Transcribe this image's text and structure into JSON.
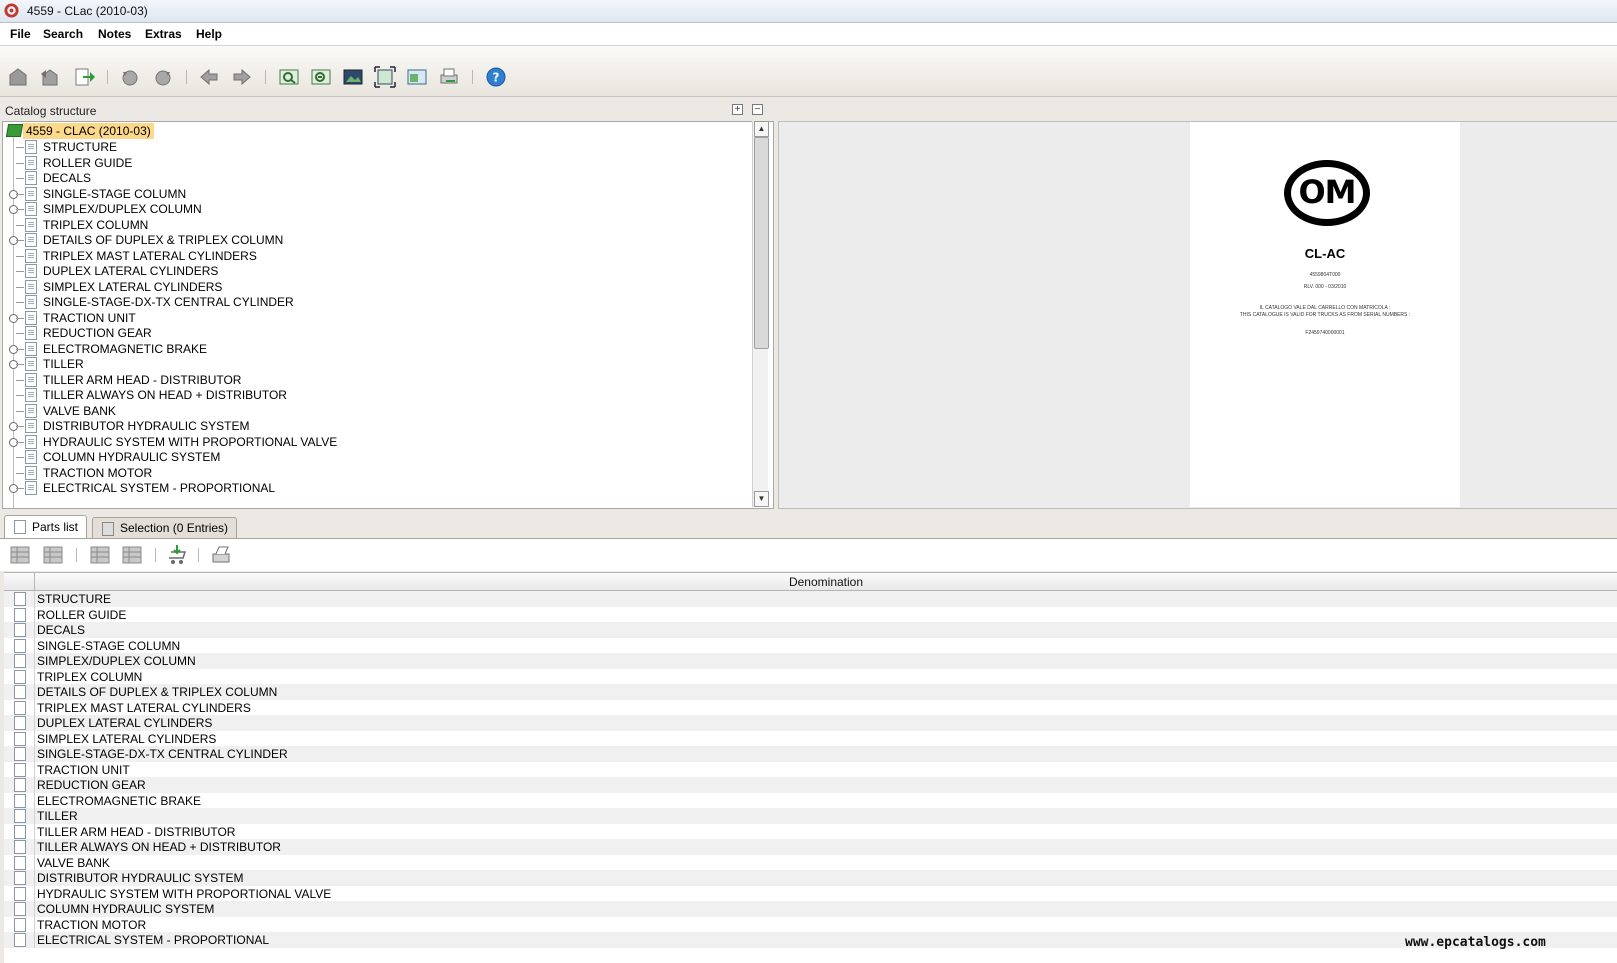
{
  "window": {
    "title": "4559 - CLac (2010-03)"
  },
  "menu": [
    "File",
    "Search",
    "Notes",
    "Extras",
    "Help"
  ],
  "toolbar_icons": [
    "home-icon",
    "back-icon",
    "export-icon",
    "undo-icon",
    "redo-icon",
    "prev-icon",
    "next-icon",
    "zoom-in-icon",
    "zoom-out-icon",
    "image-icon",
    "fit-page-icon",
    "window-icon",
    "print-icon",
    "help-icon"
  ],
  "catalog": {
    "header": "Catalog structure",
    "expand_all": "+",
    "collapse_all": "−",
    "root": "4559 - CLAC (2010-03)",
    "items": [
      {
        "label": "STRUCTURE",
        "expandable": false
      },
      {
        "label": "ROLLER GUIDE",
        "expandable": false
      },
      {
        "label": "DECALS",
        "expandable": false
      },
      {
        "label": "SINGLE-STAGE COLUMN",
        "expandable": true
      },
      {
        "label": "SIMPLEX/DUPLEX COLUMN",
        "expandable": true
      },
      {
        "label": "TRIPLEX COLUMN",
        "expandable": false
      },
      {
        "label": "DETAILS OF DUPLEX & TRIPLEX COLUMN",
        "expandable": true
      },
      {
        "label": "TRIPLEX MAST LATERAL CYLINDERS",
        "expandable": false
      },
      {
        "label": "DUPLEX LATERAL CYLINDERS",
        "expandable": false
      },
      {
        "label": "SIMPLEX LATERAL CYLINDERS",
        "expandable": false
      },
      {
        "label": "SINGLE-STAGE-DX-TX CENTRAL CYLINDER",
        "expandable": false
      },
      {
        "label": "TRACTION UNIT",
        "expandable": true
      },
      {
        "label": "REDUCTION GEAR",
        "expandable": false
      },
      {
        "label": "ELECTROMAGNETIC BRAKE",
        "expandable": true
      },
      {
        "label": "TILLER",
        "expandable": true
      },
      {
        "label": "TILLER ARM HEAD - DISTRIBUTOR",
        "expandable": false
      },
      {
        "label": "TILLER ALWAYS ON HEAD + DISTRIBUTOR",
        "expandable": false
      },
      {
        "label": "VALVE BANK",
        "expandable": false
      },
      {
        "label": "DISTRIBUTOR HYDRAULIC SYSTEM",
        "expandable": true
      },
      {
        "label": "HYDRAULIC SYSTEM WITH PROPORTIONAL VALVE",
        "expandable": true
      },
      {
        "label": "COLUMN HYDRAULIC SYSTEM",
        "expandable": false
      },
      {
        "label": "TRACTION MOTOR",
        "expandable": false
      },
      {
        "label": "ELECTRICAL SYSTEM - PROPORTIONAL",
        "expandable": true
      }
    ]
  },
  "preview": {
    "logo_text": "OM",
    "model": "CL-AC",
    "code": "4559804T000",
    "revision": "RLV. 000 - 03/2010",
    "note_it": "IL CATALOGO VALE DAL CARRELLO CON MATRICOLA :",
    "note_en": "THIS CATALOGUE IS VALID FOR TRUCKS AS FROM SERIAL NUMBERS :",
    "serial": "F2459740000001"
  },
  "tabs": [
    {
      "label": "Parts list",
      "active": true
    },
    {
      "label": "Selection (0 Entries)",
      "active": false
    }
  ],
  "parts": {
    "column_header": "Denomination",
    "rows": [
      "STRUCTURE",
      "ROLLER GUIDE",
      "DECALS",
      "SINGLE-STAGE COLUMN",
      "SIMPLEX/DUPLEX COLUMN",
      "TRIPLEX COLUMN",
      "DETAILS OF DUPLEX & TRIPLEX COLUMN",
      "TRIPLEX MAST LATERAL CYLINDERS",
      "DUPLEX LATERAL CYLINDERS",
      "SIMPLEX LATERAL CYLINDERS",
      "SINGLE-STAGE-DX-TX CENTRAL CYLINDER",
      "TRACTION UNIT",
      "REDUCTION GEAR",
      "ELECTROMAGNETIC BRAKE",
      "TILLER",
      "TILLER ARM HEAD - DISTRIBUTOR",
      "TILLER ALWAYS ON HEAD + DISTRIBUTOR",
      "VALVE BANK",
      "DISTRIBUTOR HYDRAULIC SYSTEM",
      "HYDRAULIC SYSTEM WITH PROPORTIONAL VALVE",
      "COLUMN HYDRAULIC SYSTEM",
      "TRACTION MOTOR",
      "ELECTRICAL SYSTEM - PROPORTIONAL"
    ]
  },
  "watermark": "www.epcatalogs.com",
  "colors": {
    "selection": "#fbd88a",
    "root_book": "#3a9a3a",
    "help": "#2f7fd1"
  }
}
